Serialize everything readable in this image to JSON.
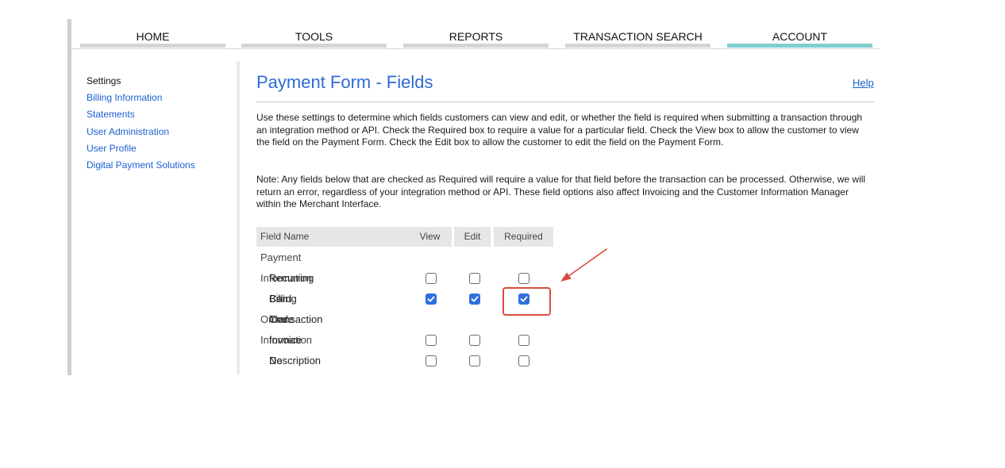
{
  "nav": {
    "tabs": [
      {
        "label": "HOME"
      },
      {
        "label": "TOOLS"
      },
      {
        "label": "REPORTS"
      },
      {
        "label": "TRANSACTION SEARCH"
      },
      {
        "label": "ACCOUNT"
      }
    ],
    "active_tab": "ACCOUNT",
    "active_color": "#7fcfcf"
  },
  "sidebar": {
    "heading": "Settings",
    "links": [
      {
        "label": "Billing Information"
      },
      {
        "label": "Statements"
      },
      {
        "label": "User Administration"
      },
      {
        "label": "User Profile"
      },
      {
        "label": "Digital Payment Solutions"
      }
    ]
  },
  "page": {
    "title": "Payment Form - Fields",
    "help_label": "Help",
    "intro": "Use these settings to determine which fields customers can view and edit, or whether the field is required when submitting a transaction through an integration method or API. Check the Required box to require a value for a particular field. Check the View box to allow the customer to view the field on the Payment Form. Check the Edit box to allow the customer to edit the field on the Payment Form.",
    "note": "Note: Any fields below that are checked as Required will require a value for that field before the transaction can be processed. Otherwise, we will return an error, regardless of your integration method or API. These field options also affect Invoicing and the Customer Information Manager within the Merchant Interface."
  },
  "table": {
    "headers": {
      "field_name": "Field Name",
      "view": "View",
      "edit": "Edit",
      "required": "Required"
    },
    "groups": [
      {
        "label": "Payment Information",
        "fields": [
          {
            "label": "Recurring Billing Transaction",
            "view": false,
            "edit": false,
            "required": false
          },
          {
            "label": "Card Code",
            "view": true,
            "edit": true,
            "required": true
          }
        ]
      },
      {
        "label": "Order Information",
        "fields": [
          {
            "label": "Invoice No",
            "view": false,
            "edit": false,
            "required": false
          },
          {
            "label": "Description",
            "view": false,
            "edit": false,
            "required": false
          }
        ]
      }
    ]
  },
  "annotation": {
    "highlight_color": "#d94c3d"
  },
  "colors": {
    "link": "#1b5fce",
    "title": "#2e6ad6",
    "checkbox_checked": "#2f6fe0"
  }
}
